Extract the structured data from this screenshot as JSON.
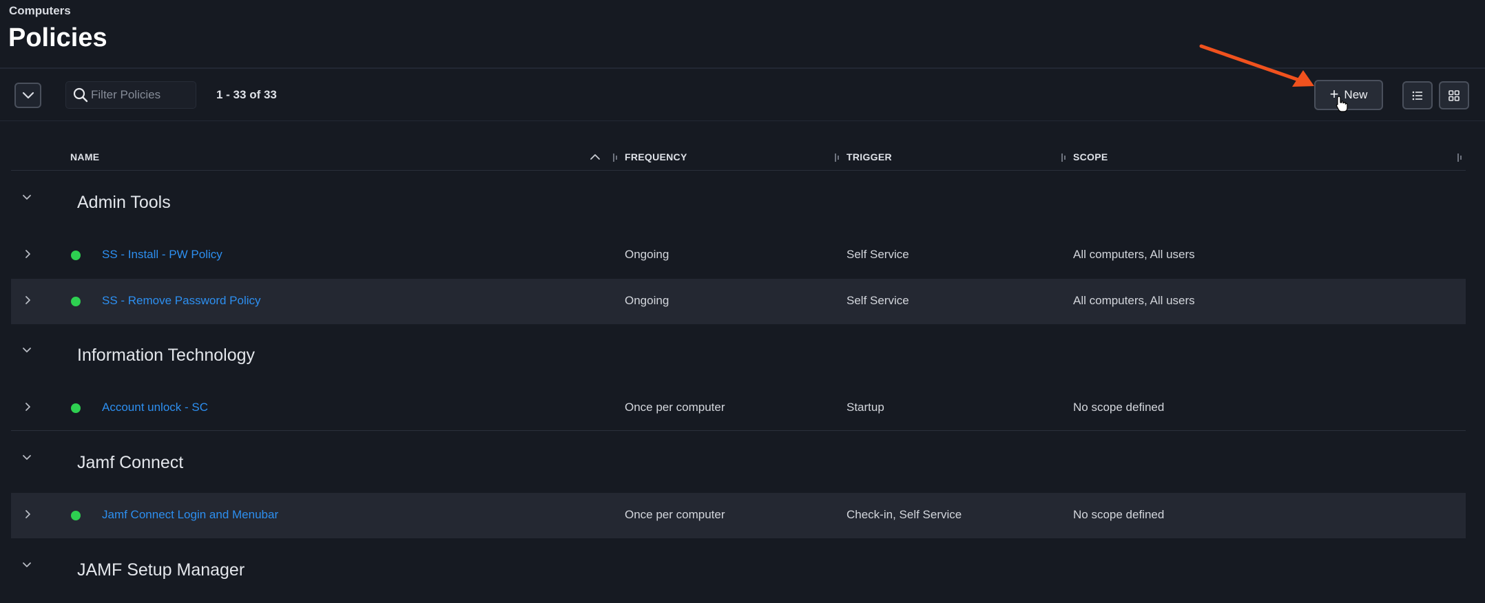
{
  "header": {
    "breadcrumb": "Computers",
    "title": "Policies"
  },
  "toolbar": {
    "search_placeholder": "Filter Policies",
    "count": "1 - 33 of 33",
    "new_label": "New"
  },
  "columns": {
    "name": "NAME",
    "frequency": "FREQUENCY",
    "trigger": "TRIGGER",
    "scope": "SCOPE"
  },
  "groups": [
    {
      "label": "Admin Tools",
      "rows": [
        {
          "name": "SS - Install - PW Policy",
          "frequency": "Ongoing",
          "trigger": "Self Service",
          "scope": "All computers, All users"
        },
        {
          "name": "SS - Remove Password Policy",
          "frequency": "Ongoing",
          "trigger": "Self Service",
          "scope": "All computers, All users"
        }
      ]
    },
    {
      "label": "Information Technology",
      "rows": [
        {
          "name": "Account unlock - SC",
          "frequency": "Once per computer",
          "trigger": "Startup",
          "scope": "No scope defined"
        }
      ]
    },
    {
      "label": "Jamf Connect",
      "rows": [
        {
          "name": "Jamf Connect Login and Menubar",
          "frequency": "Once per computer",
          "trigger": "Check-in, Self Service",
          "scope": "No scope defined"
        }
      ]
    },
    {
      "label": "JAMF Setup Manager",
      "rows": []
    }
  ],
  "colors": {
    "background": "#161a22",
    "link": "#2d8ff0",
    "status_active": "#2ed051",
    "annotation_arrow": "#f0521e"
  }
}
